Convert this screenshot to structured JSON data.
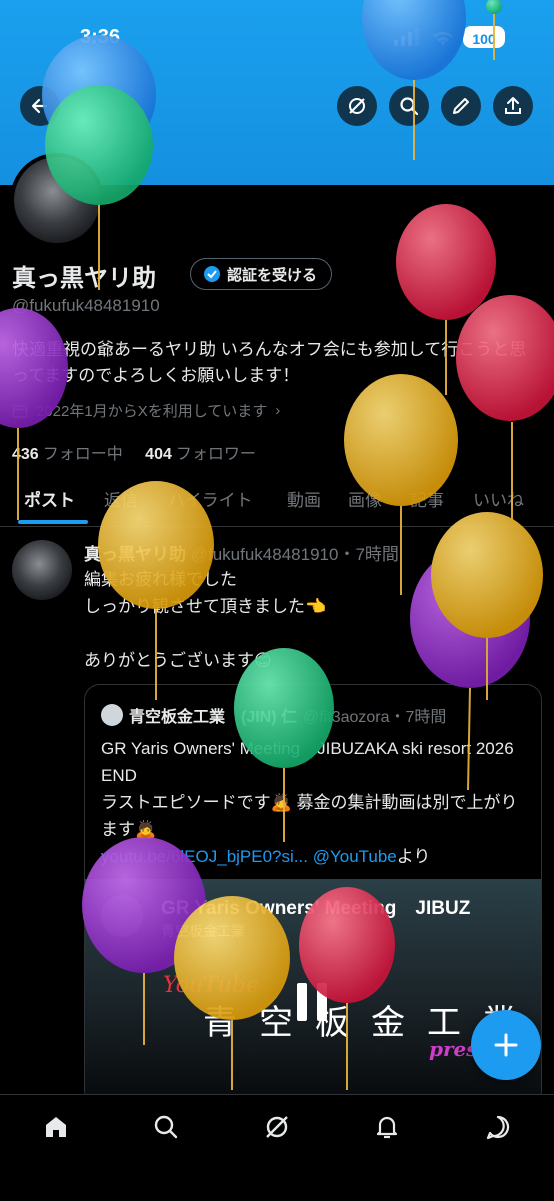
{
  "status_bar": {
    "time": "3:36",
    "battery": "100"
  },
  "header": {
    "back_icon": "arrow-left-icon",
    "grok_icon": "grok-icon",
    "search_icon": "search-icon",
    "edit_icon": "pencil-icon",
    "share_icon": "share-icon"
  },
  "profile": {
    "name": "真っ黒ヤリ助",
    "verify_label": "認証を受ける",
    "handle": "@fukufuk48481910",
    "bio": "快適重視の爺あーるヤリ助 いろんなオフ会にも参加して行こうと思ってますのでよろしくお願いします！",
    "joined": "2022年1月からXを利用しています",
    "following_count": "436",
    "following_label": "フォロー中",
    "followers_count": "404",
    "followers_label": "フォロワー"
  },
  "tabs": [
    "ポスト",
    "返信",
    "ハイライト",
    "動画",
    "画像",
    "記事",
    "いいね"
  ],
  "post": {
    "author": "真っ黒ヤリ助",
    "handle_time": "@fukufuk48481910・7時間",
    "lines": [
      "編集お疲れ様でした",
      "しっかり観させて頂きました👈",
      "",
      "ありがとうございます😊"
    ],
    "quote": {
      "author": "青空板金工業　(JIN) 仁",
      "handle_time": "@fit3aozora・7時間",
      "text": "GR Yaris Owners' Meeting　JIBUZAKA ski resort 2026 END\nラストエピソードです🙇 募金の集計動画は別で上がります🙇",
      "link": "youtu.be/6lEOJ_bjPE0?si...",
      "link2": "@YouTube",
      "link_suffix": "より",
      "media": {
        "title": "GR Yaris Owners' Meeting　JIBUZ",
        "channel": "青空板金工業",
        "overlay_big": "青空板金工業",
        "overlay_yt": "YouTube",
        "overlay_pres": "pres"
      }
    }
  },
  "fab_icon": "plus-icon",
  "bottom_nav": [
    "home-icon",
    "search-icon",
    "grok-icon",
    "bell-icon",
    "messages-icon"
  ],
  "colors": {
    "accent": "#1d9bf0",
    "banner": "#1590e0",
    "background": "#000000",
    "muted": "#71767b"
  }
}
